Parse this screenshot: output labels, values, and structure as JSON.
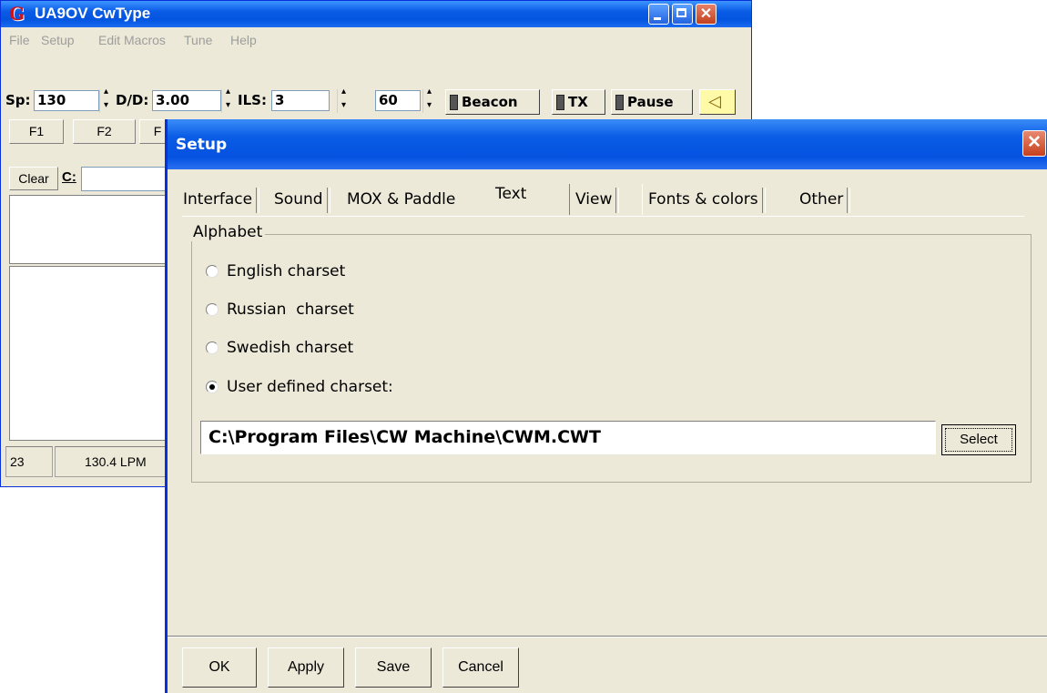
{
  "main_window": {
    "title": "UA9OV CwType",
    "menu": [
      "File",
      "Setup",
      "Edit Macros",
      "Tune",
      "Help"
    ],
    "toolbar": {
      "speed_label": "Sp:",
      "speed_value": "130",
      "dd_label": "D/D:",
      "dd_value": "3.00",
      "ils_label": "ILS:",
      "ils_value": "3",
      "extra_value": "60",
      "beacon_label": "Beacon",
      "tx_label": "TX",
      "pause_label": "Pause"
    },
    "fkeys": [
      "F1",
      "F2",
      "F"
    ],
    "clear_label": "Clear",
    "c_label": "C:",
    "status": [
      "23",
      "130.4 LPM"
    ]
  },
  "setup_dialog": {
    "title": "Setup",
    "tabs": [
      "Interface",
      "Sound",
      "MOX & Paddle",
      "Text",
      "View",
      "Fonts & colors",
      "Other"
    ],
    "active_tab": "Text",
    "group_title": "Alphabet",
    "options": [
      "English charset",
      "Russian  charset",
      "Swedish charset",
      "User defined charset:"
    ],
    "selected_option": "User defined charset:",
    "path_value": "C:\\Program Files\\CW Machine\\CWM.CWT",
    "select_label": "Select",
    "buttons": {
      "ok": "OK",
      "apply": "Apply",
      "save": "Save",
      "cancel": "Cancel"
    }
  }
}
